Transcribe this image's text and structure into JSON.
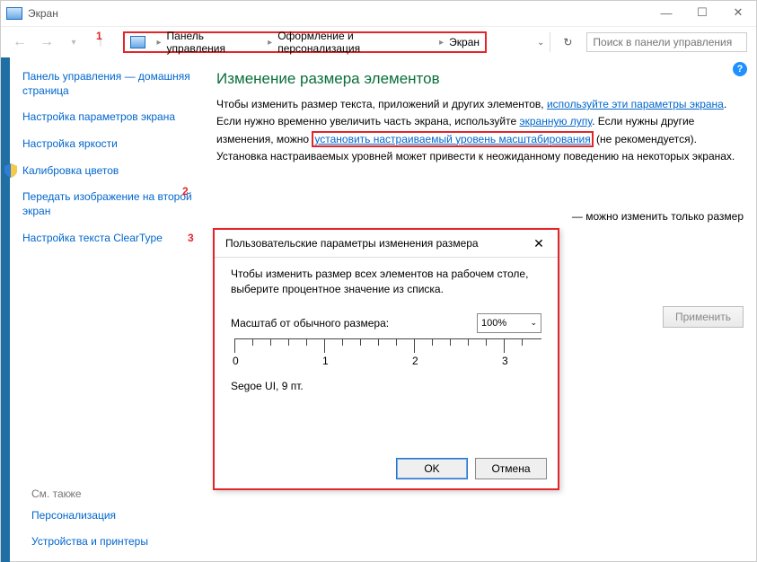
{
  "window": {
    "title": "Экран"
  },
  "breadcrumb": {
    "items": [
      "Панель управления",
      "Оформление и персонализация",
      "Экран"
    ]
  },
  "search": {
    "placeholder": "Поиск в панели управления"
  },
  "sidebar": {
    "home": "Панель управления — домашняя страница",
    "items": [
      "Настройка параметров экрана",
      "Настройка яркости",
      "Калибровка цветов",
      "Передать изображение на второй экран",
      "Настройка текста ClearType"
    ]
  },
  "see_also": {
    "title": "См. также",
    "items": [
      "Персонализация",
      "Устройства и принтеры"
    ]
  },
  "main": {
    "heading": "Изменение размера элементов",
    "line1a": "Чтобы изменить размер текста, приложений и других элементов, ",
    "link1": "используйте эти параметры экрана",
    "line2a": "Если нужно временно увеличить часть экрана, используйте ",
    "link2": "экранную лупу",
    "line2b": ". Если нужны другие",
    "line3a": "изменения, можно ",
    "link3": "установить настраиваемый уровень масштабирования",
    "line3b": " (не рекомендуется).",
    "line4": "Установка настраиваемых уровней может привести к неожиданному поведению на некоторых экранах.",
    "note_right": "можно изменить только размер",
    "apply": "Применить"
  },
  "dialog": {
    "title": "Пользовательские параметры изменения размера",
    "text": "Чтобы изменить размер всех элементов на рабочем столе, выберите процентное значение из списка.",
    "scale_label": "Масштаб от обычного размера:",
    "scale_value": "100%",
    "ruler_labels": [
      "0",
      "1",
      "2",
      "3"
    ],
    "font_sample": "Segoe UI, 9 пт.",
    "ok": "OK",
    "cancel": "Отмена"
  },
  "callouts": {
    "n1": "1",
    "n2": "2",
    "n3": "3"
  }
}
